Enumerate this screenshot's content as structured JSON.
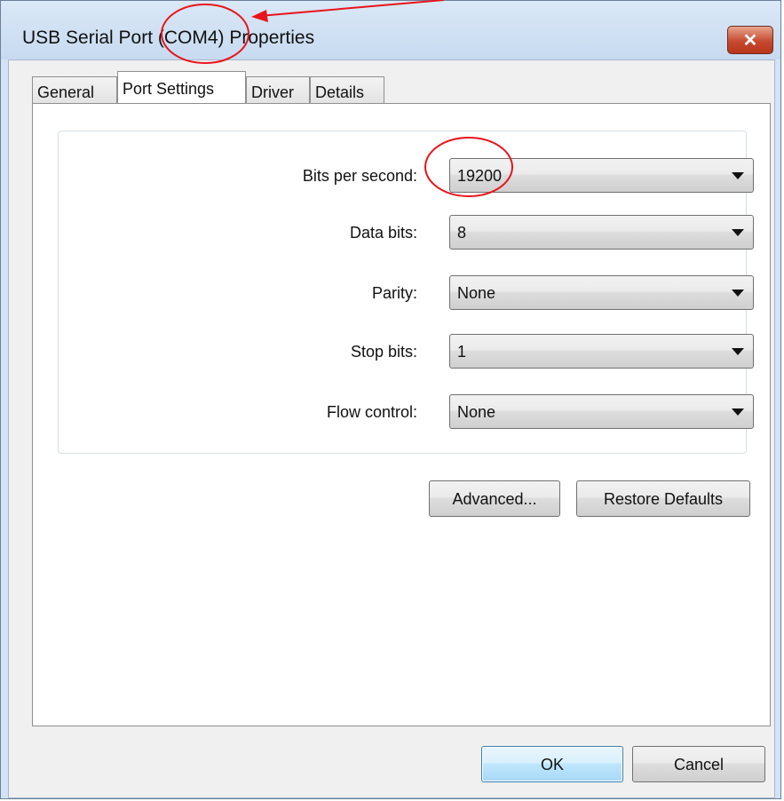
{
  "window": {
    "title": "USB Serial Port (COM4) Properties",
    "close_glyph": "✕",
    "close_icon": "close-icon"
  },
  "tabs": [
    {
      "label": "General",
      "active": false
    },
    {
      "label": "Port Settings",
      "active": true
    },
    {
      "label": "Driver",
      "active": false
    },
    {
      "label": "Details",
      "active": false
    }
  ],
  "settings": {
    "bits_per_second": {
      "label": "Bits per second:",
      "value": "19200"
    },
    "data_bits": {
      "label": "Data bits:",
      "value": "8"
    },
    "parity": {
      "label": "Parity:",
      "value": "None"
    },
    "stop_bits": {
      "label": "Stop bits:",
      "value": "1"
    },
    "flow_control": {
      "label": "Flow control:",
      "value": "None"
    }
  },
  "buttons": {
    "advanced": "Advanced...",
    "restore_defaults": "Restore Defaults",
    "ok": "OK",
    "cancel": "Cancel"
  },
  "colors": {
    "annotation": "#e8141b",
    "window_frame": "#d3e3f5",
    "close_button": "#c74a30"
  }
}
